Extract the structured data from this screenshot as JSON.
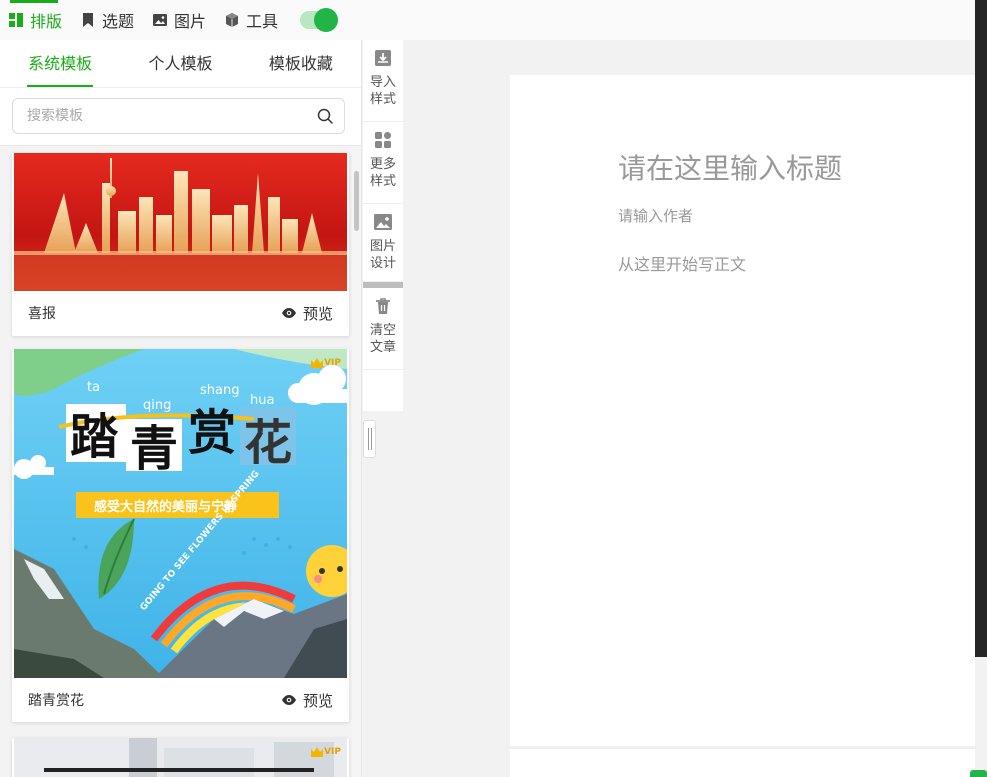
{
  "topnav": {
    "items": [
      {
        "label": "排版",
        "icon": "layout-icon",
        "active": true
      },
      {
        "label": "选题",
        "icon": "bookmark-icon",
        "active": false
      },
      {
        "label": "图片",
        "icon": "image-icon",
        "active": false
      },
      {
        "label": "工具",
        "icon": "cube-icon",
        "active": false
      }
    ],
    "toggle_on": true
  },
  "tabs": [
    "系统模板",
    "个人模板",
    "模板收藏"
  ],
  "search": {
    "placeholder": "搜索模板",
    "value": ""
  },
  "cards": [
    {
      "name": "喜报",
      "preview_label": "预览",
      "vip": false
    },
    {
      "name": "踏青赏花",
      "preview_label": "预览",
      "vip": true,
      "vip_label": "VIP",
      "art": {
        "pinyin": [
          "ta",
          "qing",
          "shang",
          "hua"
        ],
        "title": [
          "踏",
          "青",
          "赏",
          "花"
        ],
        "subtitle": "感受大自然的美丽与宁静",
        "arc_text": "GOING TO SEE FLOWERS IN SPRING"
      }
    },
    {
      "vip": true,
      "vip_label": "VIP"
    }
  ],
  "tools": [
    {
      "line1": "导入",
      "line2": "样式",
      "icon": "import-icon"
    },
    {
      "line1": "更多",
      "line2": "样式",
      "icon": "grid-icon"
    },
    {
      "line1": "图片",
      "line2": "设计",
      "icon": "image-icon"
    },
    {
      "line1": "清空",
      "line2": "文章",
      "icon": "trash-icon"
    }
  ],
  "editor": {
    "title_placeholder": "请在这里输入标题",
    "author_placeholder": "请输入作者",
    "body_placeholder": "从这里开始写正文"
  },
  "colors": {
    "accent": "#1aad19",
    "toggle": "#21b548",
    "banner_red": "#d81e1e",
    "sky_blue": "#56c3f0"
  }
}
